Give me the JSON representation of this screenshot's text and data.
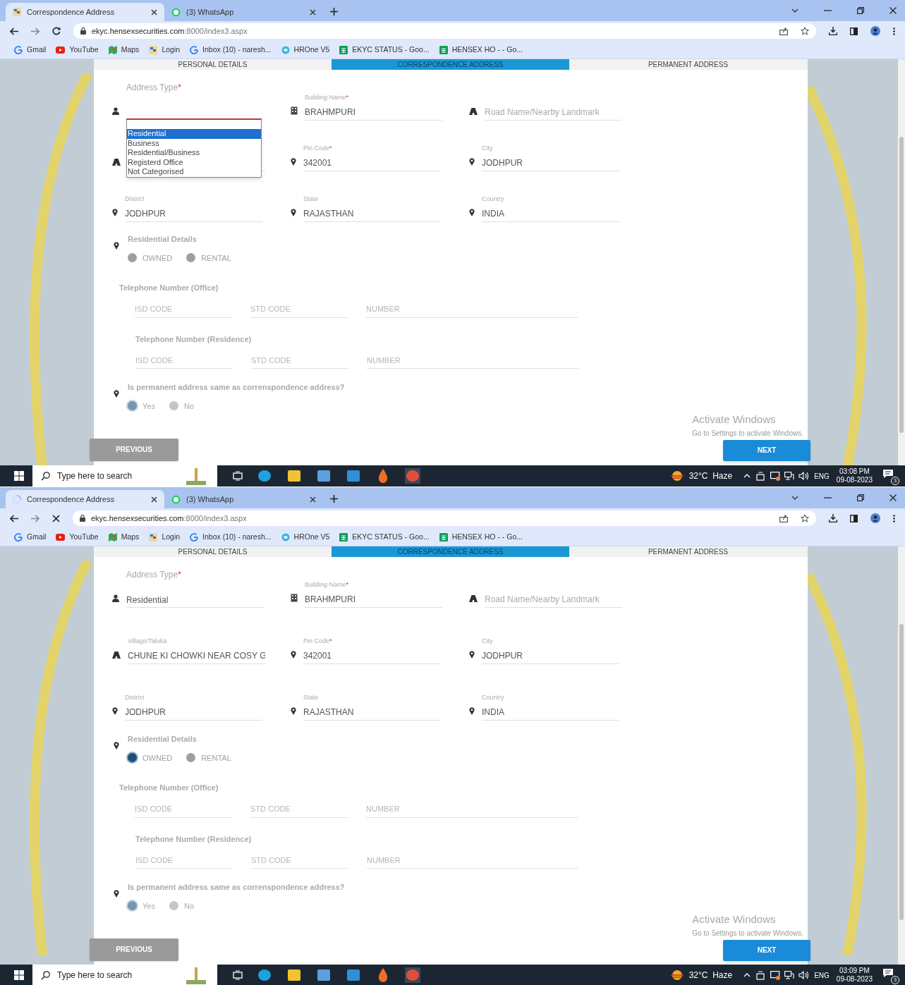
{
  "screens": [
    {
      "browser_tabs": [
        {
          "title": "Correspondence Address",
          "selected": true,
          "loading": false
        },
        {
          "title": "(3) WhatsApp",
          "selected": false,
          "loading": false
        }
      ],
      "url": {
        "host": "ekyc.hensexsecurities.com",
        "path": ":8000/index3.aspx"
      },
      "bookmarks": [
        {
          "label": "Gmail"
        },
        {
          "label": "YouTube"
        },
        {
          "label": "Maps"
        },
        {
          "label": "Login"
        },
        {
          "label": "Inbox (10) - naresh..."
        },
        {
          "label": "HROne V5"
        },
        {
          "label": "EKYC STATUS - Goo..."
        },
        {
          "label": "HENSEX HO - - Go..."
        }
      ],
      "form_tabs": [
        {
          "label": "PERSONAL DETAILS",
          "selected": false
        },
        {
          "label": "CORRESPONDENCE ADDRESS",
          "selected": true
        },
        {
          "label": "PERMANENT ADDRESS",
          "selected": false
        }
      ],
      "fields": [
        {
          "kind": "select",
          "label": "Address Type",
          "required_mark": "*",
          "dropdown": {
            "options": [
              {
                "label": "Residential",
                "selected": true
              },
              {
                "label": "Business",
                "selected": false
              },
              {
                "label": "Residential/Business",
                "selected": false
              },
              {
                "label": "Registerd Office",
                "selected": false
              },
              {
                "label": "Not Categorised",
                "selected": false
              }
            ]
          }
        },
        {
          "kind": "text",
          "label": "Building Name",
          "required_mark": "*",
          "value": "BRAHMPURI"
        },
        {
          "kind": "text",
          "placeholder": "Road Name/Nearby Landmark"
        },
        {
          "kind": "text"
        },
        {
          "kind": "text",
          "label": "Pin Code",
          "required_mark": "*",
          "value": "342001"
        },
        {
          "kind": "text",
          "label": "City",
          "value": "JODHPUR"
        },
        {
          "kind": "text",
          "label": "District",
          "value": "JODHPUR"
        },
        {
          "kind": "text",
          "label": "State",
          "value": "RAJASTHAN"
        },
        {
          "kind": "text",
          "label": "Country",
          "value": "INDIA"
        }
      ],
      "residential_details": {
        "label": "Residential Details",
        "options": [
          {
            "label": "OWNED",
            "selected": false
          },
          {
            "label": "RENTAL",
            "selected": false
          }
        ]
      },
      "phone_groups": [
        {
          "label": "Telephone Number (Office)",
          "placeholders": [
            "ISD CODE",
            "STD CODE",
            "NUMBER"
          ]
        },
        {
          "label": "Telephone Number (Residence)",
          "placeholders": [
            "ISD CODE",
            "STD CODE",
            "NUMBER"
          ]
        }
      ],
      "same_address": {
        "label": "Is permanent address same as correnspondence address?",
        "options": [
          {
            "label": "Yes",
            "selected": true
          },
          {
            "label": "No",
            "selected": false
          }
        ]
      },
      "buttons": {
        "previous": "PREVIOUS",
        "next": "NEXT"
      },
      "activation_notice": {
        "title": "Activate Windows",
        "subtitle": "Go to Settings to activate Windows."
      },
      "taskbar": {
        "search_placeholder": "Type here to search",
        "weather": "32°C  Haze",
        "language": "ENG",
        "time": "03:08 PM",
        "date": "09-08-2023",
        "notifications": "3"
      }
    },
    {
      "browser_tabs": [
        {
          "title": "Correspondence Address",
          "selected": true,
          "loading": true
        },
        {
          "title": "(3) WhatsApp",
          "selected": false,
          "loading": false
        }
      ],
      "url": {
        "host": "ekyc.hensexsecurities.com",
        "path": ":8000/index3.aspx"
      },
      "bookmarks": [
        {
          "label": "Gmail"
        },
        {
          "label": "YouTube"
        },
        {
          "label": "Maps"
        },
        {
          "label": "Login"
        },
        {
          "label": "Inbox (10) - naresh..."
        },
        {
          "label": "HROne V5"
        },
        {
          "label": "EKYC STATUS - Goo..."
        },
        {
          "label": "HENSEX HO - - Go..."
        }
      ],
      "form_tabs": [
        {
          "label": "PERSONAL DETAILS",
          "selected": false
        },
        {
          "label": "CORRESPONDENCE ADDRESS",
          "selected": true
        },
        {
          "label": "PERMANENT ADDRESS",
          "selected": false
        }
      ],
      "fields": [
        {
          "kind": "select",
          "label": "Address Type",
          "required_mark": "*",
          "value": "Residential"
        },
        {
          "kind": "text",
          "label": "Building Name",
          "required_mark": "*",
          "value": "BRAHMPURI"
        },
        {
          "kind": "text",
          "placeholder": "Road Name/Nearby Landmark"
        },
        {
          "kind": "text",
          "label": "Village/Taluka",
          "value": "CHUNE KI CHOWKI NEAR COSY G"
        },
        {
          "kind": "text",
          "label": "Pin Code",
          "required_mark": "*",
          "value": "342001"
        },
        {
          "kind": "text",
          "label": "City",
          "value": "JODHPUR"
        },
        {
          "kind": "text",
          "label": "District",
          "value": "JODHPUR"
        },
        {
          "kind": "text",
          "label": "State",
          "value": "RAJASTHAN"
        },
        {
          "kind": "text",
          "label": "Country",
          "value": "INDIA"
        }
      ],
      "residential_details": {
        "label": "Residential Details",
        "options": [
          {
            "label": "OWNED",
            "selected": true
          },
          {
            "label": "RENTAL",
            "selected": false
          }
        ]
      },
      "phone_groups": [
        {
          "label": "Telephone Number (Office)",
          "placeholders": [
            "ISD CODE",
            "STD CODE",
            "NUMBER"
          ]
        },
        {
          "label": "Telephone Number (Residence)",
          "placeholders": [
            "ISD CODE",
            "STD CODE",
            "NUMBER"
          ]
        }
      ],
      "same_address": {
        "label": "Is permanent address same as correnspondence address?",
        "options": [
          {
            "label": "Yes",
            "selected": true
          },
          {
            "label": "No",
            "selected": false
          }
        ]
      },
      "buttons": {
        "previous": "PREVIOUS",
        "next": "NEXT"
      },
      "activation_notice": {
        "title": "Activate Windows",
        "subtitle": "Go to Settings to activate Windows."
      },
      "taskbar": {
        "search_placeholder": "Type here to search",
        "weather": "32°C  Haze",
        "language": "ENG",
        "time": "03:09 PM",
        "date": "09-08-2023",
        "notifications": "3"
      }
    }
  ]
}
